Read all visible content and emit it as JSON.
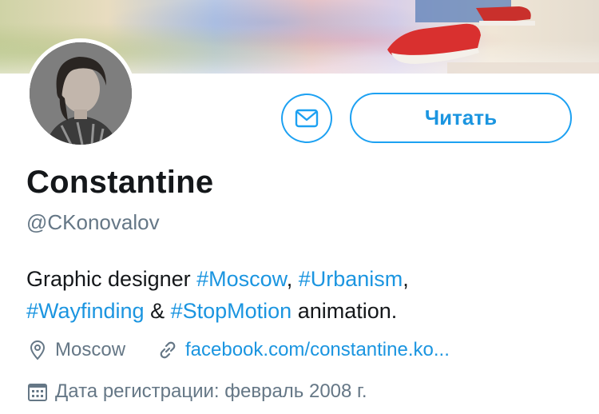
{
  "profile": {
    "name": "Constantine",
    "handle": "@CKonovalov",
    "bio": {
      "part1": "Graphic designer ",
      "tag1": "#Moscow",
      "sep1": ", ",
      "tag2": "#Urbanism",
      "sep2": ",",
      "tag3": "#Wayfinding",
      "sep3": " & ",
      "tag4": "#StopMotion",
      "part2": " animation."
    },
    "location": "Moscow",
    "website": "facebook.com/constantine.ko...",
    "joined": "Дата регистрации: февраль 2008 г."
  },
  "actions": {
    "follow_label": "Читать"
  },
  "colors": {
    "accent": "#1da1f2",
    "link": "#1b95e0",
    "secondary_text": "#657786"
  },
  "icons": {
    "message": "envelope-icon",
    "location": "location-pin-icon",
    "website": "link-icon",
    "joined": "calendar-icon"
  }
}
